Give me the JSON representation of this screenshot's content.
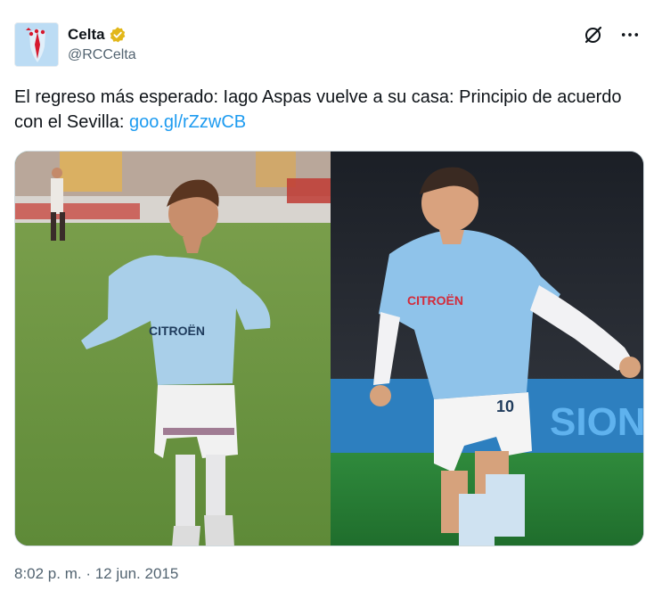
{
  "author": {
    "display_name": "Celta",
    "handle": "@RCCelta",
    "verified_badge_icon": "gold-verified-badge-icon",
    "verified_color": "#e2b719"
  },
  "actions": {
    "grok_icon": "grok-icon",
    "more_icon": "more-options-icon"
  },
  "tweet": {
    "text": "El regreso más esperado: Iago Aspas vuelve a su casa: Principio de acuerdo con el Sevilla: ",
    "link_text": "goo.gl/rZzwCB",
    "link_color": "#1d9bf0"
  },
  "media": {
    "left_jersey_sponsor": "CITROËN",
    "right_jersey_sponsor": "CITROËN",
    "right_jersey_number": "10",
    "background_banner_text": "SIONS"
  },
  "meta": {
    "time": "8:02 p. m.",
    "separator": " · ",
    "date": "12 jun. 2015"
  }
}
